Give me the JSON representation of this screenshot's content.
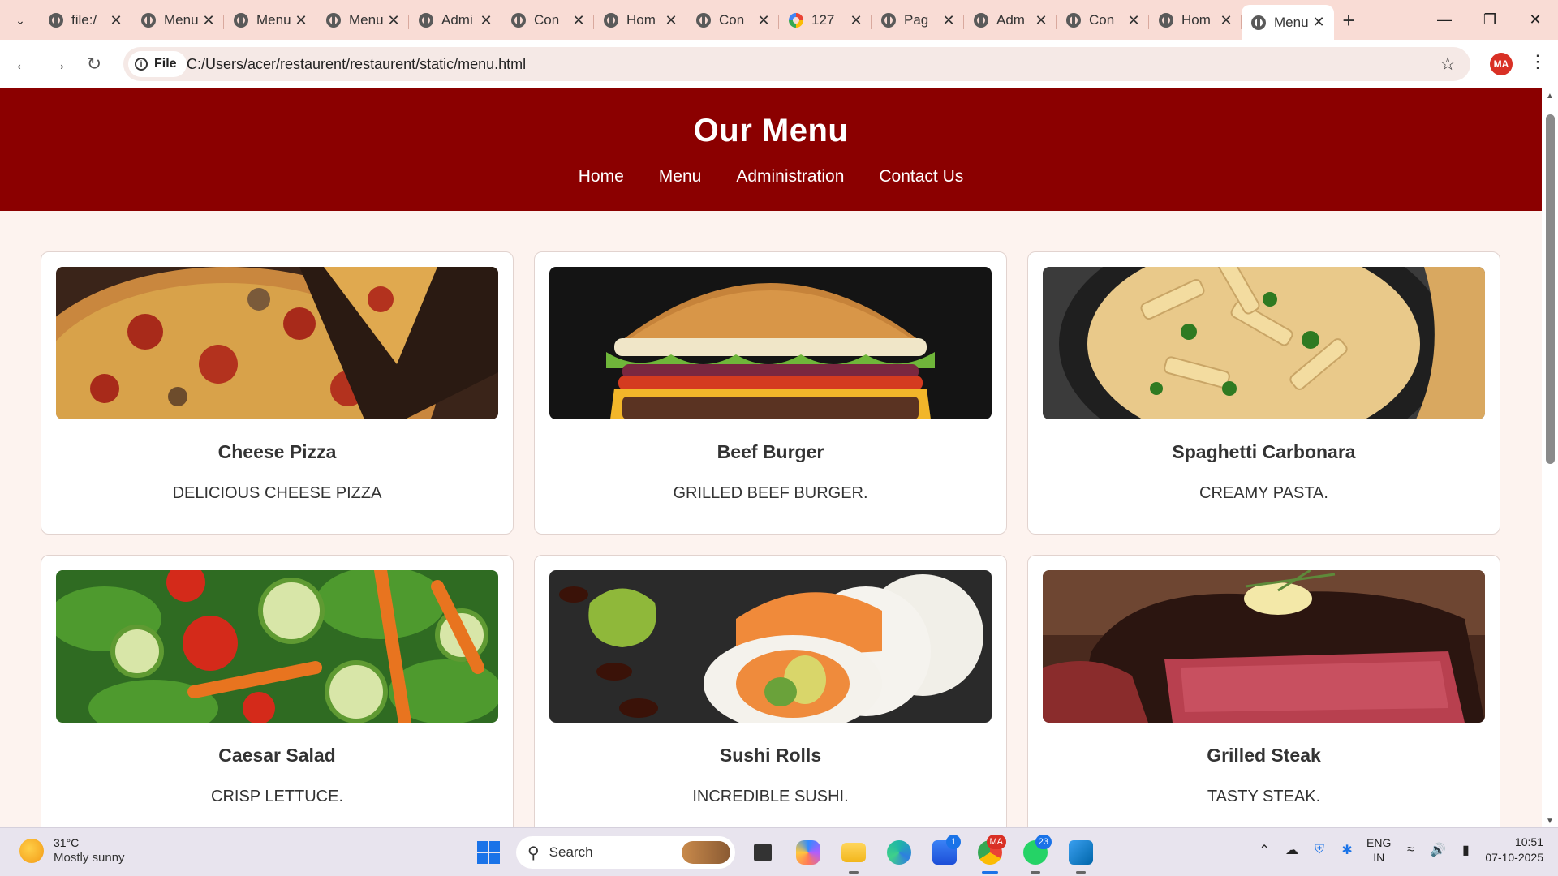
{
  "browser": {
    "tabs": [
      {
        "title": "file:/",
        "favicon": "globe-icon"
      },
      {
        "title": "Menu",
        "favicon": "globe-icon"
      },
      {
        "title": "Menu",
        "favicon": "globe-icon"
      },
      {
        "title": "Menu",
        "favicon": "globe-icon"
      },
      {
        "title": "Admi",
        "favicon": "globe-icon"
      },
      {
        "title": "Con",
        "favicon": "globe-icon"
      },
      {
        "title": "Hom",
        "favicon": "globe-icon"
      },
      {
        "title": "Con",
        "favicon": "globe-icon"
      },
      {
        "title": "127",
        "favicon": "google-icon"
      },
      {
        "title": "Pag",
        "favicon": "globe-icon"
      },
      {
        "title": "Adm",
        "favicon": "globe-icon"
      },
      {
        "title": "Con",
        "favicon": "globe-icon"
      },
      {
        "title": "Hom",
        "favicon": "globe-icon"
      },
      {
        "title": "Menu",
        "favicon": "globe-icon",
        "active": true
      }
    ],
    "url_scheme_label": "File",
    "url": "C:/Users/acer/restaurent/restaurent/static/menu.html",
    "profile_initials": "MA"
  },
  "page": {
    "title": "Our Menu",
    "nav": [
      "Home",
      "Menu",
      "Administration",
      "Contact Us"
    ],
    "items": [
      {
        "name": "Cheese Pizza",
        "desc": "Delicious cheese pizza",
        "image": "pizza"
      },
      {
        "name": "Beef Burger",
        "desc": "Grilled beef burger.",
        "image": "burger"
      },
      {
        "name": "Spaghetti Carbonara",
        "desc": "Creamy pasta.",
        "image": "pasta"
      },
      {
        "name": "Caesar Salad",
        "desc": "Crisp lettuce.",
        "image": "salad"
      },
      {
        "name": "Sushi Rolls",
        "desc": "Incredible sushi.",
        "image": "sushi"
      },
      {
        "name": "Grilled Steak",
        "desc": "Tasty steak.",
        "image": "steak"
      }
    ],
    "colors": {
      "header_bg": "#8b0000",
      "page_bg": "#fdf3ef"
    }
  },
  "taskbar": {
    "weather_temp": "31°C",
    "weather_desc": "Mostly sunny",
    "search_placeholder": "Search",
    "chrome_badge": "MA",
    "store_badge": "1",
    "whatsapp_badge": "23",
    "lang_line1": "ENG",
    "lang_line2": "IN",
    "time": "10:51",
    "date": "07-10-2025"
  }
}
